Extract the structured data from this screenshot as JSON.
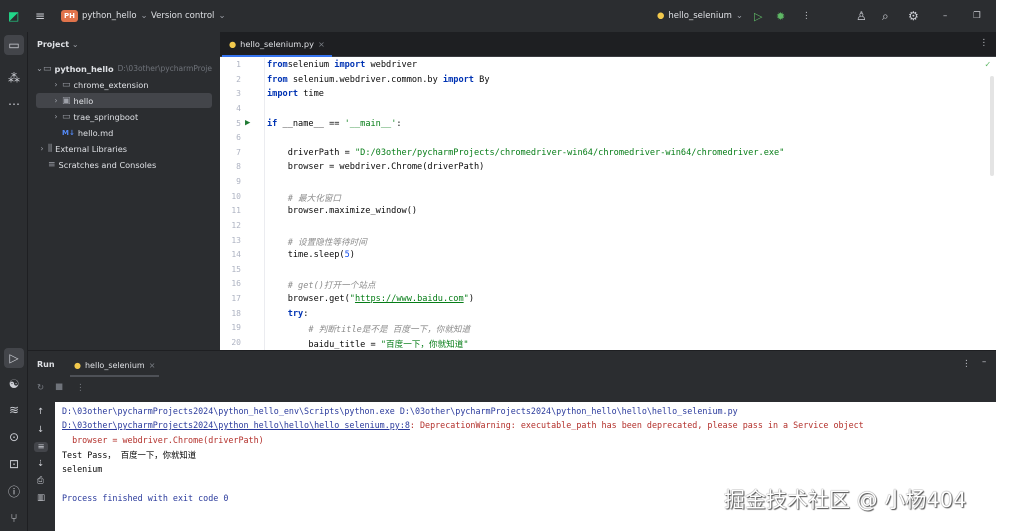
{
  "titlebar": {
    "project_badge": "PH",
    "project": "python_hello",
    "vcs": "Version control",
    "run_config": "hello_selenium"
  },
  "project_panel": {
    "title": "Project",
    "tree": [
      {
        "label": "python_hello",
        "hint": "D:\\03other\\pycharmProje",
        "level": 0,
        "expanded": true,
        "bold": true,
        "icon": "folder"
      },
      {
        "label": "chrome_extension",
        "level": 1,
        "icon": "folder"
      },
      {
        "label": "hello",
        "level": 1,
        "icon": "package-folder",
        "selected": true
      },
      {
        "label": "trae_springboot",
        "level": 1,
        "icon": "folder"
      },
      {
        "label": "hello.md",
        "level": 1,
        "icon": "markdown",
        "badge": "M↓"
      },
      {
        "label": "External Libraries",
        "level": 0,
        "icon": "library"
      },
      {
        "label": "Scratches and Consoles",
        "level": 0,
        "icon": "scratches"
      }
    ]
  },
  "editor": {
    "tab": "hello_selenium.py",
    "lines": [
      [
        [
          "kw",
          "from"
        ],
        [
          "",
          "selenium "
        ],
        [
          "kw",
          "import"
        ],
        [
          "",
          " webdriver"
        ]
      ],
      [
        [
          "kw",
          "from"
        ],
        [
          "",
          " selenium.webdriver.common.by "
        ],
        [
          "kw",
          "import"
        ],
        [
          "",
          " By"
        ]
      ],
      [
        [
          "kw",
          "import"
        ],
        [
          "",
          " time"
        ]
      ],
      [],
      [
        [
          "kw",
          "if"
        ],
        [
          "",
          " __name__ == "
        ],
        [
          "str",
          "'__main__'"
        ],
        [
          "",
          ":"
        ]
      ],
      [],
      [
        [
          "",
          "    driverPath = "
        ],
        [
          "str",
          "\"D:/03other/pycharmProjects/chromedriver-win64/chromedriver-win64/chromedriver.exe\""
        ]
      ],
      [
        [
          "",
          "    browser = webdriver.Chrome(driverPath)"
        ]
      ],
      [],
      [
        [
          "cm",
          "    # 最大化窗口"
        ]
      ],
      [
        [
          "",
          "    browser.maximize_window()"
        ]
      ],
      [],
      [
        [
          "cm",
          "    # 设置隐性等待时间"
        ]
      ],
      [
        [
          "",
          "    time.sleep("
        ],
        [
          "num",
          "5"
        ],
        [
          "",
          ")"
        ]
      ],
      [],
      [
        [
          "cm",
          "    # get()打开一个站点"
        ]
      ],
      [
        [
          "",
          "    browser.get("
        ],
        [
          "str",
          "\""
        ],
        [
          "url",
          "https://www.baidu.com"
        ],
        [
          "str",
          "\""
        ],
        [
          "",
          ")"
        ]
      ],
      [
        [
          "kw",
          "    try"
        ],
        [
          "",
          ":"
        ]
      ],
      [
        [
          "cm",
          "        # 判断title是不是 百度一下，你就知道"
        ]
      ],
      [
        [
          "",
          "        baidu_title = "
        ],
        [
          "str",
          "\"百度一下，你就知道\""
        ]
      ]
    ]
  },
  "run": {
    "title": "Run",
    "tab": "hello_selenium",
    "console": [
      {
        "text": "D:\\03other\\pycharmProjects2024\\python_hello_env\\Scripts\\python.exe D:\\03other\\pycharmProjects2024\\python_hello\\hello\\hello_selenium.py",
        "color": "#2a3a9c"
      },
      {
        "link": "D:\\03other\\pycharmProjects2024\\python_hello\\hello\\hello_selenium.py:8",
        "text": ": DeprecationWarning: executable_path has been deprecated, please pass in a Service object",
        "color": "#b3302b"
      },
      {
        "text": "  browser = webdriver.Chrome(driverPath)",
        "color": "#b3302b"
      },
      {
        "text": "Test Pass， 百度一下，你就知道",
        "color": "#080808"
      },
      {
        "text": "selenium",
        "color": "#080808"
      },
      {
        "text": "",
        "color": "#080808"
      },
      {
        "text": "Process finished with exit code 0",
        "color": "#2a3a9c"
      }
    ]
  },
  "watermark": "掘金技术社区 @ 小杨404",
  "colors": {
    "accent": "#3574f0",
    "run_green": "#5fb865",
    "warning": "#b3302b"
  }
}
